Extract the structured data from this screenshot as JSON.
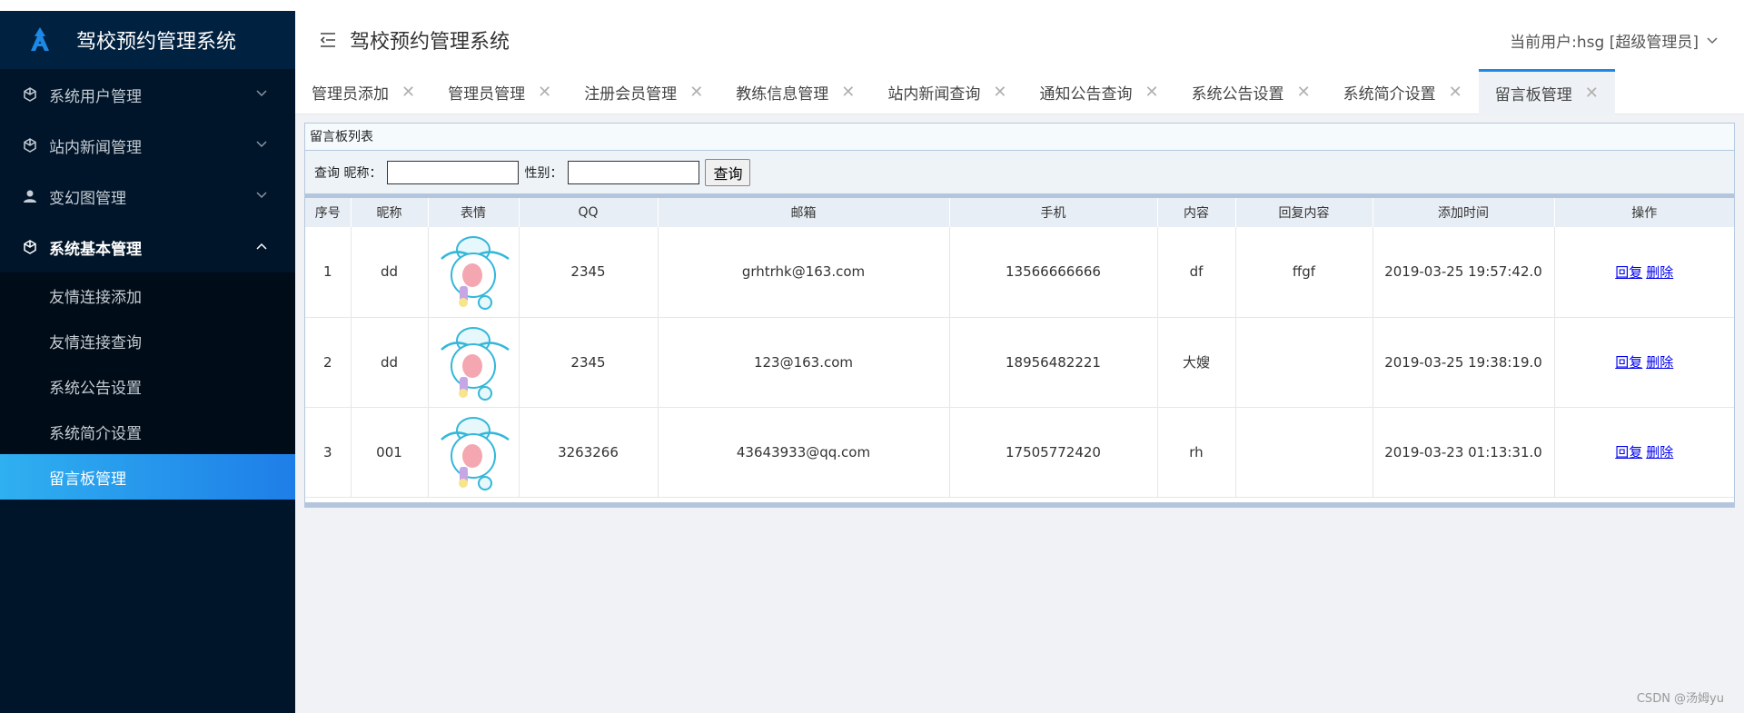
{
  "app": {
    "title": "驾校预约管理系统",
    "user_text": "当前用户:hsg [超级管理员]"
  },
  "sidebar": {
    "menus": [
      {
        "label": "系统用户管理",
        "icon": "cube-icon"
      },
      {
        "label": "站内新闻管理",
        "icon": "cube-icon"
      },
      {
        "label": "变幻图管理",
        "icon": "user-icon"
      },
      {
        "label": "系统基本管理",
        "icon": "cube-icon"
      }
    ],
    "submenu": [
      {
        "label": "友情连接添加"
      },
      {
        "label": "友情连接查询"
      },
      {
        "label": "系统公告设置"
      },
      {
        "label": "系统简介设置"
      },
      {
        "label": "留言板管理"
      }
    ]
  },
  "tabs": [
    {
      "label": "管理员添加"
    },
    {
      "label": "管理员管理"
    },
    {
      "label": "注册会员管理"
    },
    {
      "label": "教练信息管理"
    },
    {
      "label": "站内新闻查询"
    },
    {
      "label": "通知公告查询"
    },
    {
      "label": "系统公告设置"
    },
    {
      "label": "系统简介设置"
    },
    {
      "label": "留言板管理"
    }
  ],
  "panel": {
    "title": "留言板列表",
    "search": {
      "prefix": "查询 昵称：",
      "nickname_value": "",
      "gender_label": "性别：",
      "gender_value": "",
      "button": "查询"
    },
    "columns": [
      "序号",
      "昵称",
      "表情",
      "QQ",
      "邮箱",
      "手机",
      "内容",
      "回复内容",
      "添加时间",
      "操作"
    ],
    "rows": [
      {
        "no": "1",
        "nickname": "dd",
        "qq": "2345",
        "email": "grhtrhk@163.com",
        "phone": "13566666666",
        "content": "df",
        "reply": "ffgf",
        "time": "2019-03-25 19:57:42.0"
      },
      {
        "no": "2",
        "nickname": "dd",
        "qq": "2345",
        "email": "123@163.com",
        "phone": "18956482221",
        "content": "大嫂",
        "reply": "",
        "time": "2019-03-25 19:38:19.0"
      },
      {
        "no": "3",
        "nickname": "001",
        "qq": "3263266",
        "email": "43643933@qq.com",
        "phone": "17505772420",
        "content": "rh",
        "reply": "",
        "time": "2019-03-23 01:13:31.0"
      }
    ],
    "ops": {
      "reply": "回复",
      "delete": "删除"
    }
  },
  "watermark": "CSDN @汤姆yu"
}
